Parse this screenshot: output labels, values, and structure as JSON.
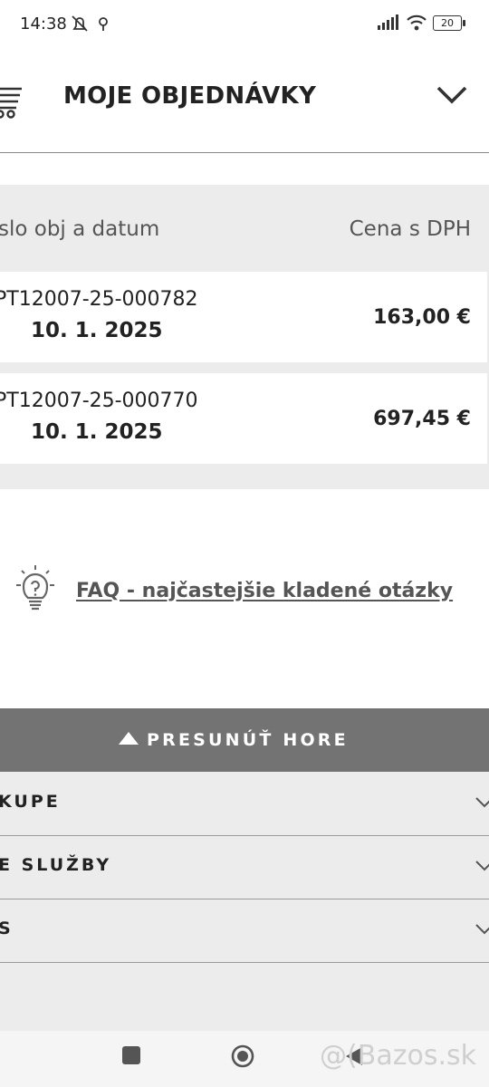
{
  "status_bar": {
    "time": "14:38",
    "battery": "20",
    "icons": [
      "alarm-off-icon",
      "location-icon",
      "signal-icon",
      "wifi-icon",
      "battery-icon"
    ]
  },
  "header": {
    "title": "MOJE OBJEDNÁVKY",
    "icons": [
      "cart-icon",
      "chevron-down-icon"
    ]
  },
  "orders": {
    "column_left": "slo obj a datum",
    "column_right": "Cena s DPH",
    "rows": [
      {
        "order_no": "PT12007-25-000782",
        "date": "10. 1. 2025",
        "price": "163,00 €"
      },
      {
        "order_no": "PT12007-25-000770",
        "date": "10. 1. 2025",
        "price": "697,45 €"
      }
    ]
  },
  "faq": {
    "label": "FAQ - najčastejšie kladené otázky"
  },
  "back_to_top": {
    "label": "PRESUNÚŤ HORE"
  },
  "footer_sections": [
    {
      "label": "KUPE"
    },
    {
      "label": "E SLUŽBY"
    },
    {
      "label": "S"
    }
  ],
  "watermark": "@(Bazos.sk",
  "colors": {
    "dark_bar": "#737373",
    "panel": "#ececec",
    "text": "#222222"
  }
}
